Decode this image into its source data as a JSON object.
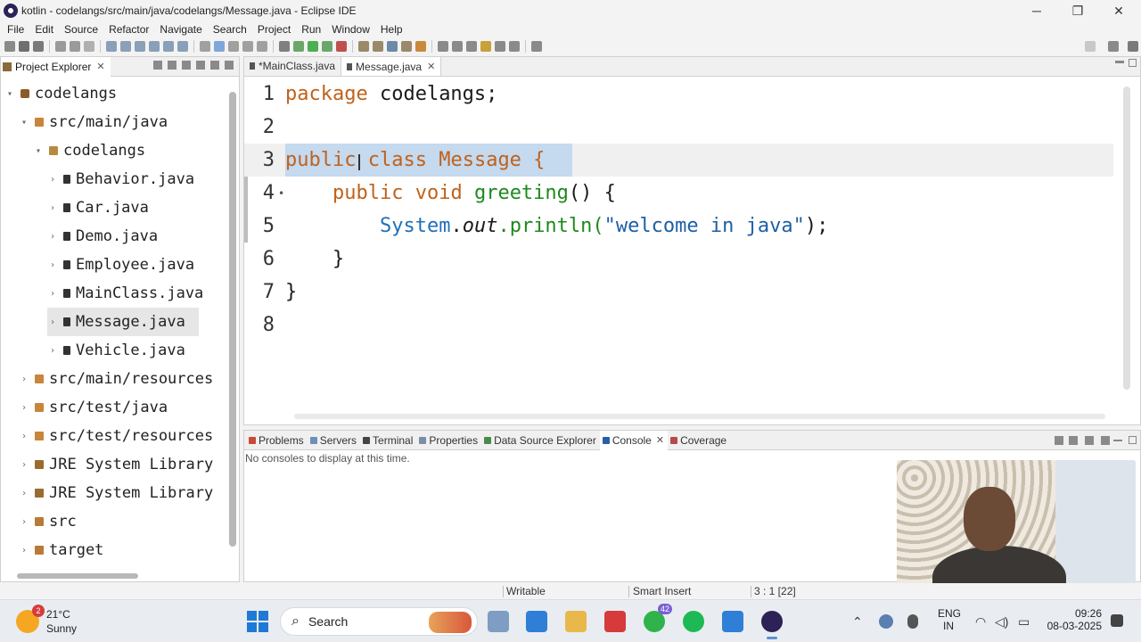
{
  "window": {
    "title": "kotlin - codelangs/src/main/java/codelangs/Message.java - Eclipse IDE",
    "minimize": "─",
    "restore": "❐",
    "close": "✕"
  },
  "menu": [
    "File",
    "Edit",
    "Source",
    "Refactor",
    "Navigate",
    "Search",
    "Project",
    "Run",
    "Window",
    "Help"
  ],
  "explorer": {
    "tab_label": "Project Explorer",
    "close": "✕",
    "tree": [
      {
        "label": "codelangs",
        "twisty": "▾",
        "icon": "project-icon"
      },
      {
        "label": "src/main/java",
        "twisty": "▾",
        "icon": "package-folder-icon"
      },
      {
        "label": "codelangs",
        "twisty": "▾",
        "icon": "package-icon"
      },
      {
        "label": "Behavior.java",
        "twisty": "›",
        "icon": "java-file-icon"
      },
      {
        "label": "Car.java",
        "twisty": "›",
        "icon": "java-file-icon"
      },
      {
        "label": "Demo.java",
        "twisty": "›",
        "icon": "java-file-icon"
      },
      {
        "label": "Employee.java",
        "twisty": "›",
        "icon": "java-file-icon"
      },
      {
        "label": "MainClass.java",
        "twisty": "›",
        "icon": "java-file-icon"
      },
      {
        "label": "Message.java",
        "twisty": "›",
        "icon": "java-file-icon"
      },
      {
        "label": "Vehicle.java",
        "twisty": "›",
        "icon": "java-file-icon"
      },
      {
        "label": "src/main/resources",
        "twisty": "›",
        "icon": "package-folder-icon"
      },
      {
        "label": "src/test/java",
        "twisty": "›",
        "icon": "package-folder-icon"
      },
      {
        "label": "src/test/resources",
        "twisty": "›",
        "icon": "package-folder-icon"
      },
      {
        "label": "JRE System Library",
        "twisty": "›",
        "icon": "library-icon"
      },
      {
        "label": "JRE System Library",
        "twisty": "›",
        "icon": "library-icon"
      },
      {
        "label": "src",
        "twisty": "›",
        "icon": "folder-icon"
      },
      {
        "label": "target",
        "twisty": "›",
        "icon": "folder-icon"
      }
    ]
  },
  "editor": {
    "tabs": [
      {
        "label": "*MainClass.java",
        "active": false
      },
      {
        "label": "Message.java",
        "active": true,
        "close": "✕"
      }
    ],
    "line_numbers": [
      "1",
      "2",
      "3",
      "4",
      "5",
      "6",
      "7",
      "8"
    ],
    "code": {
      "l1_kw": "package",
      "l1_rest": " codelangs;",
      "l3_kw1": "public",
      "l3_kw2": "class",
      "l3_rest": " Message {",
      "l4_indent": "    ",
      "l4_kw1": "public",
      "l4_kw2": "void",
      "l4_meth": "greeting",
      "l4_rest": "() {",
      "l5_indent": "        ",
      "l5_sys": "System",
      "l5_dot": ".",
      "l5_out": "out",
      "l5_println": ".println(",
      "l5_str": "\"welcome in java\"",
      "l5_end": ");",
      "l6": "    }",
      "l7": "}"
    },
    "l4_marker": "•"
  },
  "console": {
    "tabs": [
      {
        "label": "Problems",
        "icon_color": "#c94a3a"
      },
      {
        "label": "Servers",
        "icon_color": "#6b8fb8"
      },
      {
        "label": "Terminal",
        "icon_color": "#444444"
      },
      {
        "label": "Properties",
        "icon_color": "#7a8fa6"
      },
      {
        "label": "Data Source Explorer",
        "icon_color": "#4a8a4a"
      },
      {
        "label": "Console",
        "icon_color": "#2a5fa8",
        "active": true
      },
      {
        "label": "Coverage",
        "icon_color": "#b84a4a"
      }
    ],
    "close": "✕",
    "message": "No consoles to display at this time."
  },
  "status": {
    "writable": "Writable",
    "insert_mode": "Smart Insert",
    "position": "3 : 1 [22]"
  },
  "taskbar": {
    "weather_temp": "21°C",
    "weather_desc": "Sunny",
    "weather_badge": "2",
    "search_label": "Search",
    "search_glyph": "⌕",
    "whatsapp_count": "42",
    "language": "ENG",
    "region": "IN",
    "time": "09:26",
    "date": "08-03-2025",
    "tray_up": "⌃",
    "wifi": "◠",
    "volume": "◁)",
    "battery": "▭"
  },
  "colors": {
    "keyword": "#7f0055",
    "package_keyword": "#c0621a",
    "method": "#1d8a1d",
    "system": "#1f6fb8",
    "string": "#1d5fa5",
    "selection": "#c5d9ef"
  }
}
